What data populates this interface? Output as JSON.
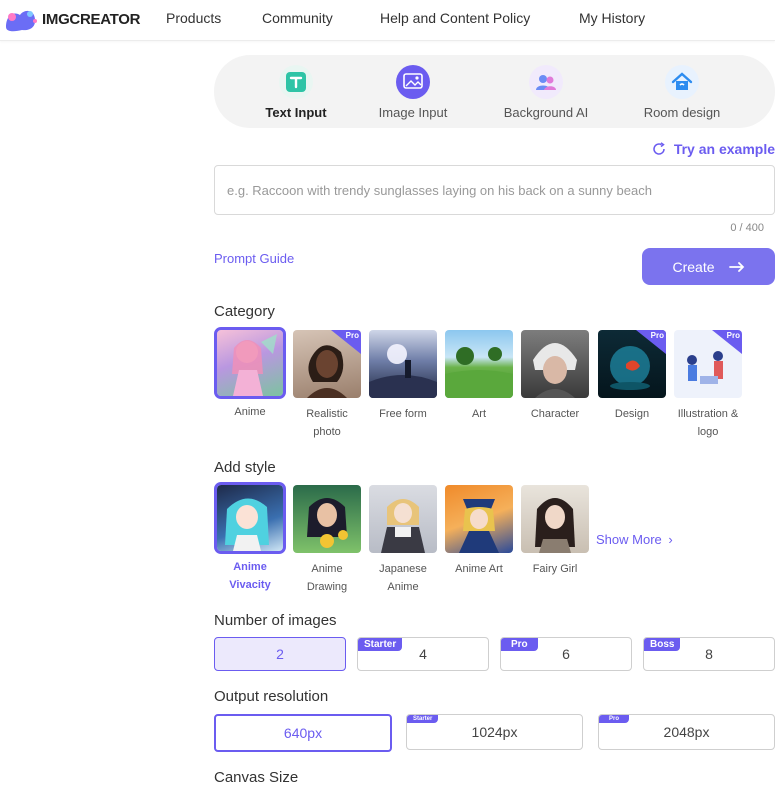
{
  "header": {
    "logo_text": "IMGCREATOR",
    "nav": [
      "Products",
      "Community",
      "Help and Content Policy",
      "My History"
    ]
  },
  "mode_tabs": [
    {
      "label": "Text Input",
      "icon": "text-t-icon",
      "color": "#2ec4a6",
      "active": true
    },
    {
      "label": "Image Input",
      "icon": "image-icon",
      "color": "#6b5cf0",
      "active": false
    },
    {
      "label": "Background AI",
      "icon": "people-icon",
      "color": "#c67cf2",
      "active": false
    },
    {
      "label": "Room design",
      "icon": "house-icon",
      "color": "#2d8cf0",
      "active": false
    }
  ],
  "prompt": {
    "try_example": "Try an example",
    "placeholder": "e.g. Raccoon with trendy sunglasses laying on his back on a sunny beach",
    "value": "",
    "counter": "0 / 400",
    "guide_link": "Prompt Guide",
    "create_label": "Create"
  },
  "category": {
    "title": "Category",
    "pro_label": "Pro",
    "items": [
      {
        "label": "Anime",
        "selected": true,
        "pro": false
      },
      {
        "label": "Realistic photo",
        "selected": false,
        "pro": true
      },
      {
        "label": "Free form",
        "selected": false,
        "pro": false
      },
      {
        "label": "Art",
        "selected": false,
        "pro": false
      },
      {
        "label": "Character",
        "selected": false,
        "pro": false
      },
      {
        "label": "Design",
        "selected": false,
        "pro": true
      },
      {
        "label": "Illustration & logo",
        "selected": false,
        "pro": true
      }
    ]
  },
  "style": {
    "title": "Add style",
    "show_more": "Show More",
    "items": [
      {
        "label": "Anime Vivacity",
        "selected": true
      },
      {
        "label": "Anime Drawing",
        "selected": false
      },
      {
        "label": "Japanese Anime",
        "selected": false
      },
      {
        "label": "Anime Art",
        "selected": false
      },
      {
        "label": "Fairy Girl",
        "selected": false
      }
    ]
  },
  "num_images": {
    "title": "Number of images",
    "options": [
      {
        "value": "2",
        "tier": "",
        "selected": true
      },
      {
        "value": "4",
        "tier": "Starter",
        "selected": false
      },
      {
        "value": "6",
        "tier": "Pro",
        "selected": false
      },
      {
        "value": "8",
        "tier": "Boss",
        "selected": false
      }
    ]
  },
  "resolution": {
    "title": "Output resolution",
    "options": [
      {
        "value": "640px",
        "tier": "",
        "selected": true
      },
      {
        "value": "1024px",
        "tier": "Starter",
        "selected": false
      },
      {
        "value": "2048px",
        "tier": "Pro",
        "selected": false
      }
    ]
  },
  "canvas": {
    "title": "Canvas Size"
  },
  "colors": {
    "accent": "#6b5cf0",
    "create_button": "#7b73ee",
    "tabs_bg": "#f3f3f3"
  }
}
